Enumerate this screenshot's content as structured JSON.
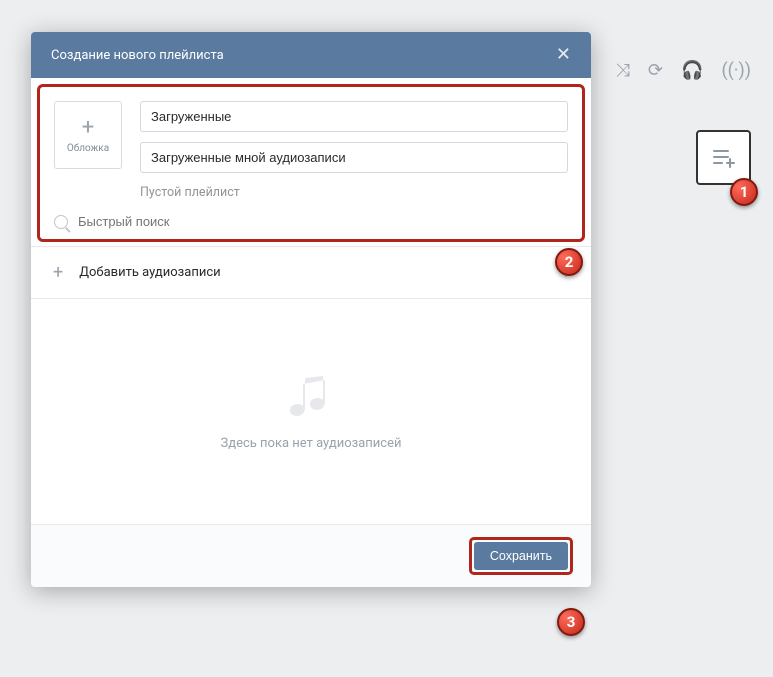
{
  "modal": {
    "title": "Создание нового плейлиста",
    "cover_label": "Обложка",
    "title_input": "Загруженные",
    "desc_input": "Загруженные мной аудиозаписи",
    "empty_playlist_hint": "Пустой плейлист",
    "search_placeholder": "Быстрый поиск",
    "add_audio_label": "Добавить аудиозаписи",
    "empty_body_msg": "Здесь пока нет аудиозаписей",
    "save_label": "Сохранить"
  },
  "annotations": {
    "b1": "1",
    "b2": "2",
    "b3": "3"
  }
}
